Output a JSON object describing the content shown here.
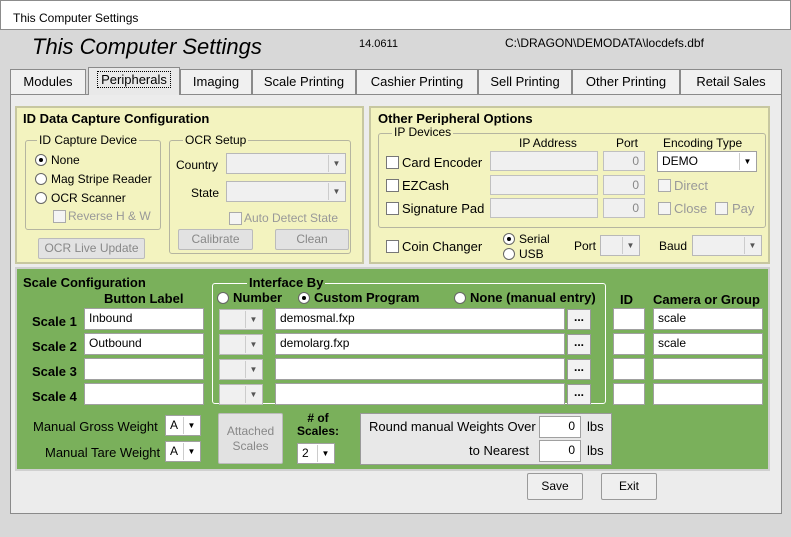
{
  "window": {
    "title": "This Computer Settings"
  },
  "header": {
    "title": "This Computer Settings",
    "version": "14.0611",
    "path": "C:\\DRAGON\\DEMODATA\\locdefs.dbf"
  },
  "tabs": [
    "Modules",
    "Peripherals",
    "Imaging",
    "Scale Printing",
    "Cashier Printing",
    "Sell Printing",
    "Other Printing",
    "Retail Sales"
  ],
  "id_capture": {
    "title": "ID Data Capture Configuration",
    "device_group": "ID Capture Device",
    "options": [
      "None",
      "Mag Stripe Reader",
      "OCR Scanner"
    ],
    "selected": "None",
    "reverse": "Reverse H & W",
    "ocr_group": "OCR Setup",
    "country": "Country",
    "state": "State",
    "auto_detect": "Auto Detect State",
    "calibrate": "Calibrate",
    "clean": "Clean",
    "ocr_live": "OCR Live Update"
  },
  "other_peripherals": {
    "title": "Other Peripheral Options",
    "ip_group": "IP Devices",
    "col_ip": "IP Address",
    "col_port": "Port",
    "col_enc": "Encoding Type",
    "devices": [
      {
        "label": "Card Encoder",
        "port": "0"
      },
      {
        "label": "EZCash",
        "port": "0"
      },
      {
        "label": "Signature Pad",
        "port": "0"
      }
    ],
    "encoding": "DEMO",
    "direct": "Direct",
    "close": "Close",
    "pay": "Pay",
    "coin_changer": "Coin Changer",
    "serial": "Serial",
    "usb": "USB",
    "port_label": "Port",
    "baud_label": "Baud"
  },
  "scale": {
    "title": "Scale Configuration",
    "button_label": "Button Label",
    "interface_by": "Interface By",
    "opt_number": "Number",
    "opt_custom": "Custom Program",
    "opt_none": "None (manual entry)",
    "id_label": "ID",
    "camera_label": "Camera or Group",
    "rows": [
      {
        "name": "Scale 1",
        "label": "Inbound",
        "program": "demosmal.fxp",
        "camera": "scale"
      },
      {
        "name": "Scale 2",
        "label": "Outbound",
        "program": "demolarg.fxp",
        "camera": "scale"
      },
      {
        "name": "Scale 3",
        "label": "",
        "program": "",
        "camera": ""
      },
      {
        "name": "Scale 4",
        "label": "",
        "program": "",
        "camera": ""
      }
    ],
    "dots": "...",
    "gross": "Manual Gross Weight",
    "gross_val": "A",
    "tare": "Manual Tare Weight",
    "tare_val": "A",
    "attached": "Attached Scales",
    "num_scales": "# of Scales:",
    "num_scales_val": "2",
    "round_over": "Round manual Weights Over",
    "round_over_val": "0",
    "nearest": "to Nearest",
    "nearest_val": "0",
    "lbs": "lbs"
  },
  "footer": {
    "save": "Save",
    "exit": "Exit"
  }
}
